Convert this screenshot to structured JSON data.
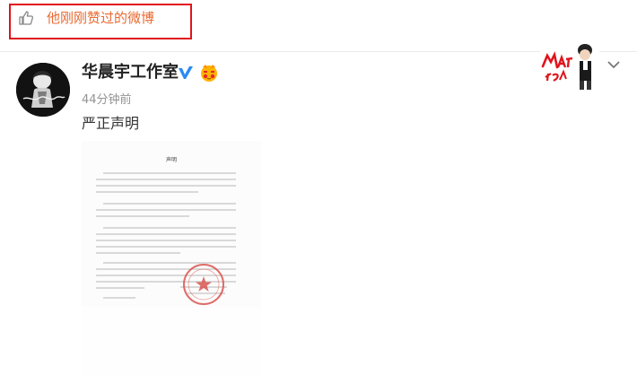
{
  "liked_bar": {
    "label": "他刚刚赞过的微博"
  },
  "post": {
    "author": "华晨宇工作室",
    "time": "44分钟前",
    "text": "严正声明"
  },
  "document": {
    "title": "声明"
  },
  "colors": {
    "highlight_border": "#e0141b",
    "liked_text": "#e86a31",
    "verified": "#2b8af3",
    "seal": "#d9534f"
  },
  "icons": [
    "thumbs-up-icon",
    "verified-icon",
    "member-badge-icon",
    "chevron-down-icon"
  ]
}
